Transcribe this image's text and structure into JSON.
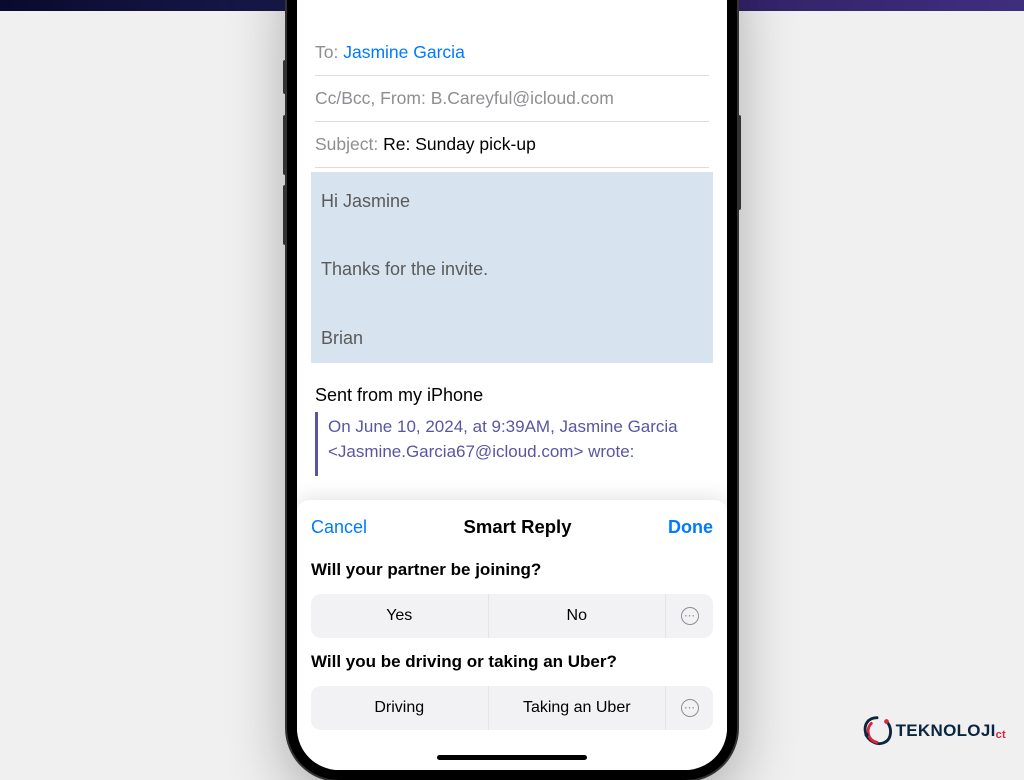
{
  "email": {
    "to_label": "To:",
    "to_recipient": "Jasmine Garcia",
    "ccbcc_label": "Cc/Bcc, From:",
    "from_value": "B.Careyful@icloud.com",
    "subject_label": "Subject:",
    "subject_value": "Re: Sunday pick-up",
    "body_line1": "Hi Jasmine",
    "body_line2": "Thanks for the invite.",
    "body_line3": "Brian",
    "signature": "Sent from my iPhone",
    "quote": "On June 10, 2024, at 9:39AM, Jasmine Garcia <Jasmine.Garcia67@icloud.com> wrote:"
  },
  "sheet": {
    "cancel": "Cancel",
    "title": "Smart Reply",
    "done": "Done",
    "questions": [
      {
        "prompt": "Will your partner be joining?",
        "options": [
          "Yes",
          "No"
        ]
      },
      {
        "prompt": "Will you be driving or taking an Uber?",
        "options": [
          "Driving",
          "Taking an Uber"
        ]
      }
    ]
  },
  "brand": {
    "name_main": "TEKNOLOJI",
    "name_suffix": "ct"
  }
}
